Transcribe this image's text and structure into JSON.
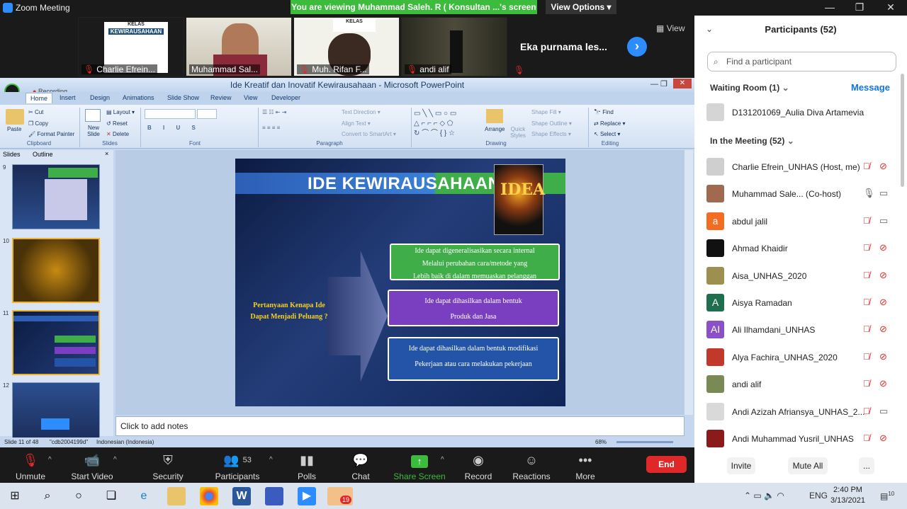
{
  "window": {
    "title": "Zoom Meeting"
  },
  "share_banner": {
    "text": "You are viewing Muhammad Saleh. R ( Konsultan ...'s screen",
    "view_options": "View Options ▾"
  },
  "video_strip": {
    "tiles": [
      {
        "name": "Charlie Efrein...",
        "muted": true
      },
      {
        "name": "Muhammad Sal...",
        "muted": false
      },
      {
        "name": "Muh. Rifan F...",
        "muted": true
      },
      {
        "name": "andi alif",
        "muted": true
      },
      {
        "name": "Eka purnama les...",
        "muted": true
      }
    ],
    "kelas_line1": "KELAS",
    "kelas_line2": "KEWIRAUSAHAAN",
    "view_label": "View"
  },
  "recording_label": "Recording",
  "powerpoint": {
    "title": "Ide Kreatif dan Inovatif Kewirausahaan - Microsoft PowerPoint",
    "tabs": [
      "Home",
      "Insert",
      "Design",
      "Animations",
      "Slide Show",
      "Review",
      "View",
      "Developer"
    ],
    "clipboard": {
      "paste": "Paste",
      "cut": "Cut",
      "copy": "Copy",
      "format_painter": "Format Painter",
      "group": "Clipboard"
    },
    "slides_group": {
      "new_slide": "New Slide",
      "layout": "Layout",
      "reset": "Reset",
      "delete": "Delete",
      "group": "Slides"
    },
    "font_group": "Font",
    "paragraph_group": {
      "text_direction": "Text Direction",
      "align_text": "Align Text",
      "convert": "Convert to SmartArt",
      "group": "Paragraph"
    },
    "drawing_group": {
      "arrange": "Arrange",
      "quick_styles": "Quick Styles",
      "shape_fill": "Shape Fill",
      "shape_outline": "Shape Outline",
      "shape_effects": "Shape Effects",
      "group": "Drawing"
    },
    "editing_group": {
      "find": "Find",
      "replace": "Replace",
      "select": "Select",
      "group": "Editing"
    },
    "pane_tabs": [
      "Slides",
      "Outline"
    ],
    "thumb_numbers": [
      "9",
      "10",
      "11",
      "12"
    ],
    "slide": {
      "heading": "IDE KEWIRAUSAHAAN",
      "idea": "IDEA",
      "question_line1": "Pertanyaan Kenapa Ide",
      "question_line2": "Dapat Menjadi Peluang ?",
      "box1": [
        "Ide dapat digeneralisasikan secara internal",
        "Melalui perubahan cara/metode yang",
        "Lebih baik di dalam memuaskan pelanggan"
      ],
      "box2": [
        "Ide dapat dihasilkan dalam bentuk",
        "Produk dan Jasa"
      ],
      "box3": [
        "Ide dapat dihasilkan dalam bentuk modifikasi",
        "Pekerjaan atau cara melakukan pekerjaan"
      ]
    },
    "notes": "Click to add notes",
    "status": {
      "slide": "Slide 11 of 48",
      "theme": "\"cdb2004199d\"",
      "language": "Indonesian (Indonesia)",
      "zoom": "68%"
    }
  },
  "toolbar": {
    "unmute": "Unmute",
    "start_video": "Start Video",
    "security": "Security",
    "participants": "Participants",
    "participants_count": "53",
    "polls": "Polls",
    "chat": "Chat",
    "share_screen": "Share Screen",
    "record": "Record",
    "reactions": "Reactions",
    "more": "More",
    "end": "End"
  },
  "participants_panel": {
    "title": "Participants (52)",
    "search_placeholder": "Find a participant",
    "waiting_room": "Waiting Room (1)",
    "message": "Message",
    "waiting": [
      {
        "name": "D131201069_Aulia Diva Artamevia"
      }
    ],
    "in_meeting": "In the Meeting (52)",
    "members": [
      {
        "name": "Charlie Efrein_UNHAS (Host, me)",
        "avatar": "",
        "color": "#cfcfcf",
        "mic": false,
        "cam": false
      },
      {
        "name": "Muhammad Sale...   (Co-host)",
        "avatar": "",
        "color": "#a06a50",
        "mic": true,
        "cam": true
      },
      {
        "name": "abdul jalil",
        "avatar": "a",
        "color": "#f26d21",
        "mic": false,
        "cam": true
      },
      {
        "name": "Ahmad Khaidir",
        "avatar": "",
        "color": "#111111",
        "mic": false,
        "cam": false
      },
      {
        "name": "Aisa_UNHAS_2020",
        "avatar": "",
        "color": "#9c8f4f",
        "mic": false,
        "cam": false
      },
      {
        "name": "Aisya Ramadan",
        "avatar": "A",
        "color": "#1f6e4f",
        "mic": false,
        "cam": false
      },
      {
        "name": "Ali Ilhamdani_UNHAS",
        "avatar": "AI",
        "color": "#8b4fc7",
        "mic": false,
        "cam": false
      },
      {
        "name": "Alya Fachira_UNHAS_2020",
        "avatar": "",
        "color": "#c0392b",
        "mic": false,
        "cam": false
      },
      {
        "name": "andi alif",
        "avatar": "",
        "color": "#7a8a55",
        "mic": false,
        "cam": false
      },
      {
        "name": "Andi Azizah Afriansya_UNHAS_2...",
        "avatar": "",
        "color": "#d9d9d9",
        "mic": false,
        "cam": true
      },
      {
        "name": "Andi Muhammad Yusril_UNHAS",
        "avatar": "",
        "color": "#8b1a1a",
        "mic": false,
        "cam": false
      }
    ],
    "invite": "Invite",
    "mute_all": "Mute All",
    "more": "..."
  },
  "taskbar": {
    "time": "2:40 PM",
    "date": "3/13/2021",
    "lang": "ENG",
    "badge": "19",
    "notif": "10"
  }
}
